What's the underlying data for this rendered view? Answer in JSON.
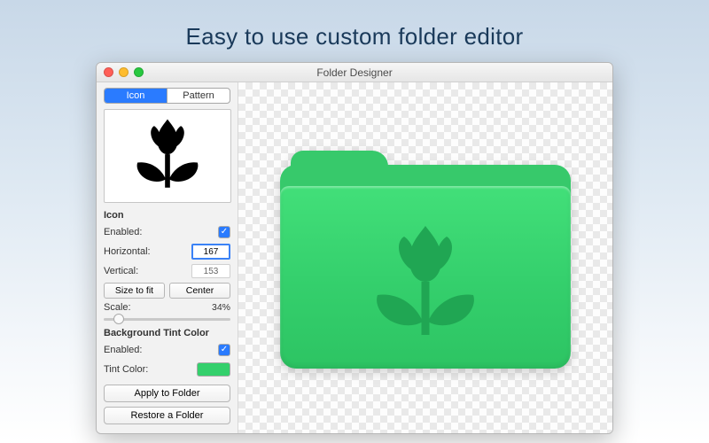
{
  "headline": "Easy to use custom folder editor",
  "window": {
    "title": "Folder Designer"
  },
  "tabs": {
    "icon": "Icon",
    "pattern": "Pattern",
    "active": "icon"
  },
  "icon_section": {
    "title": "Icon",
    "enabled_label": "Enabled:",
    "enabled": true,
    "horizontal_label": "Horizontal:",
    "horizontal": "167",
    "vertical_label": "Vertical:",
    "vertical": "153",
    "size_to_fit": "Size to fit",
    "center": "Center",
    "scale_label": "Scale:",
    "scale_display": "34%",
    "scale_value": 34
  },
  "tint_section": {
    "title": "Background Tint Color",
    "enabled_label": "Enabled:",
    "enabled": true,
    "tint_label": "Tint Color:",
    "tint_hex": "#34d06c"
  },
  "actions": {
    "apply": "Apply to Folder",
    "restore": "Restore a Folder"
  }
}
